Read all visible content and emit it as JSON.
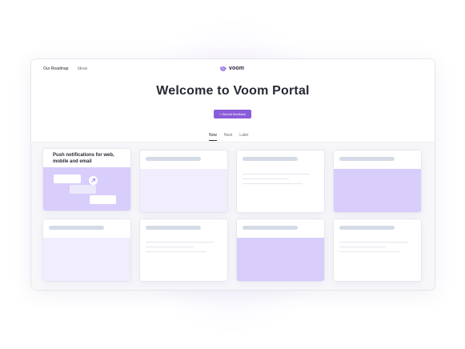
{
  "nav": {
    "roadmap_label": "Our Roadmap",
    "ideas_label": "Ideas"
  },
  "brand": {
    "name": "voom",
    "accent_color": "#8b5cd9"
  },
  "hero": {
    "title": "Welcome to Voom Portal",
    "submit_label": "+ Submit feedback"
  },
  "tabs": [
    {
      "label": "Now",
      "active": true
    },
    {
      "label": "Next",
      "active": false
    },
    {
      "label": "Later",
      "active": false
    }
  ],
  "board": {
    "featured_card": {
      "title": "Push notifications for web, mobile and email",
      "icon": "arrow-up-right-icon"
    }
  }
}
